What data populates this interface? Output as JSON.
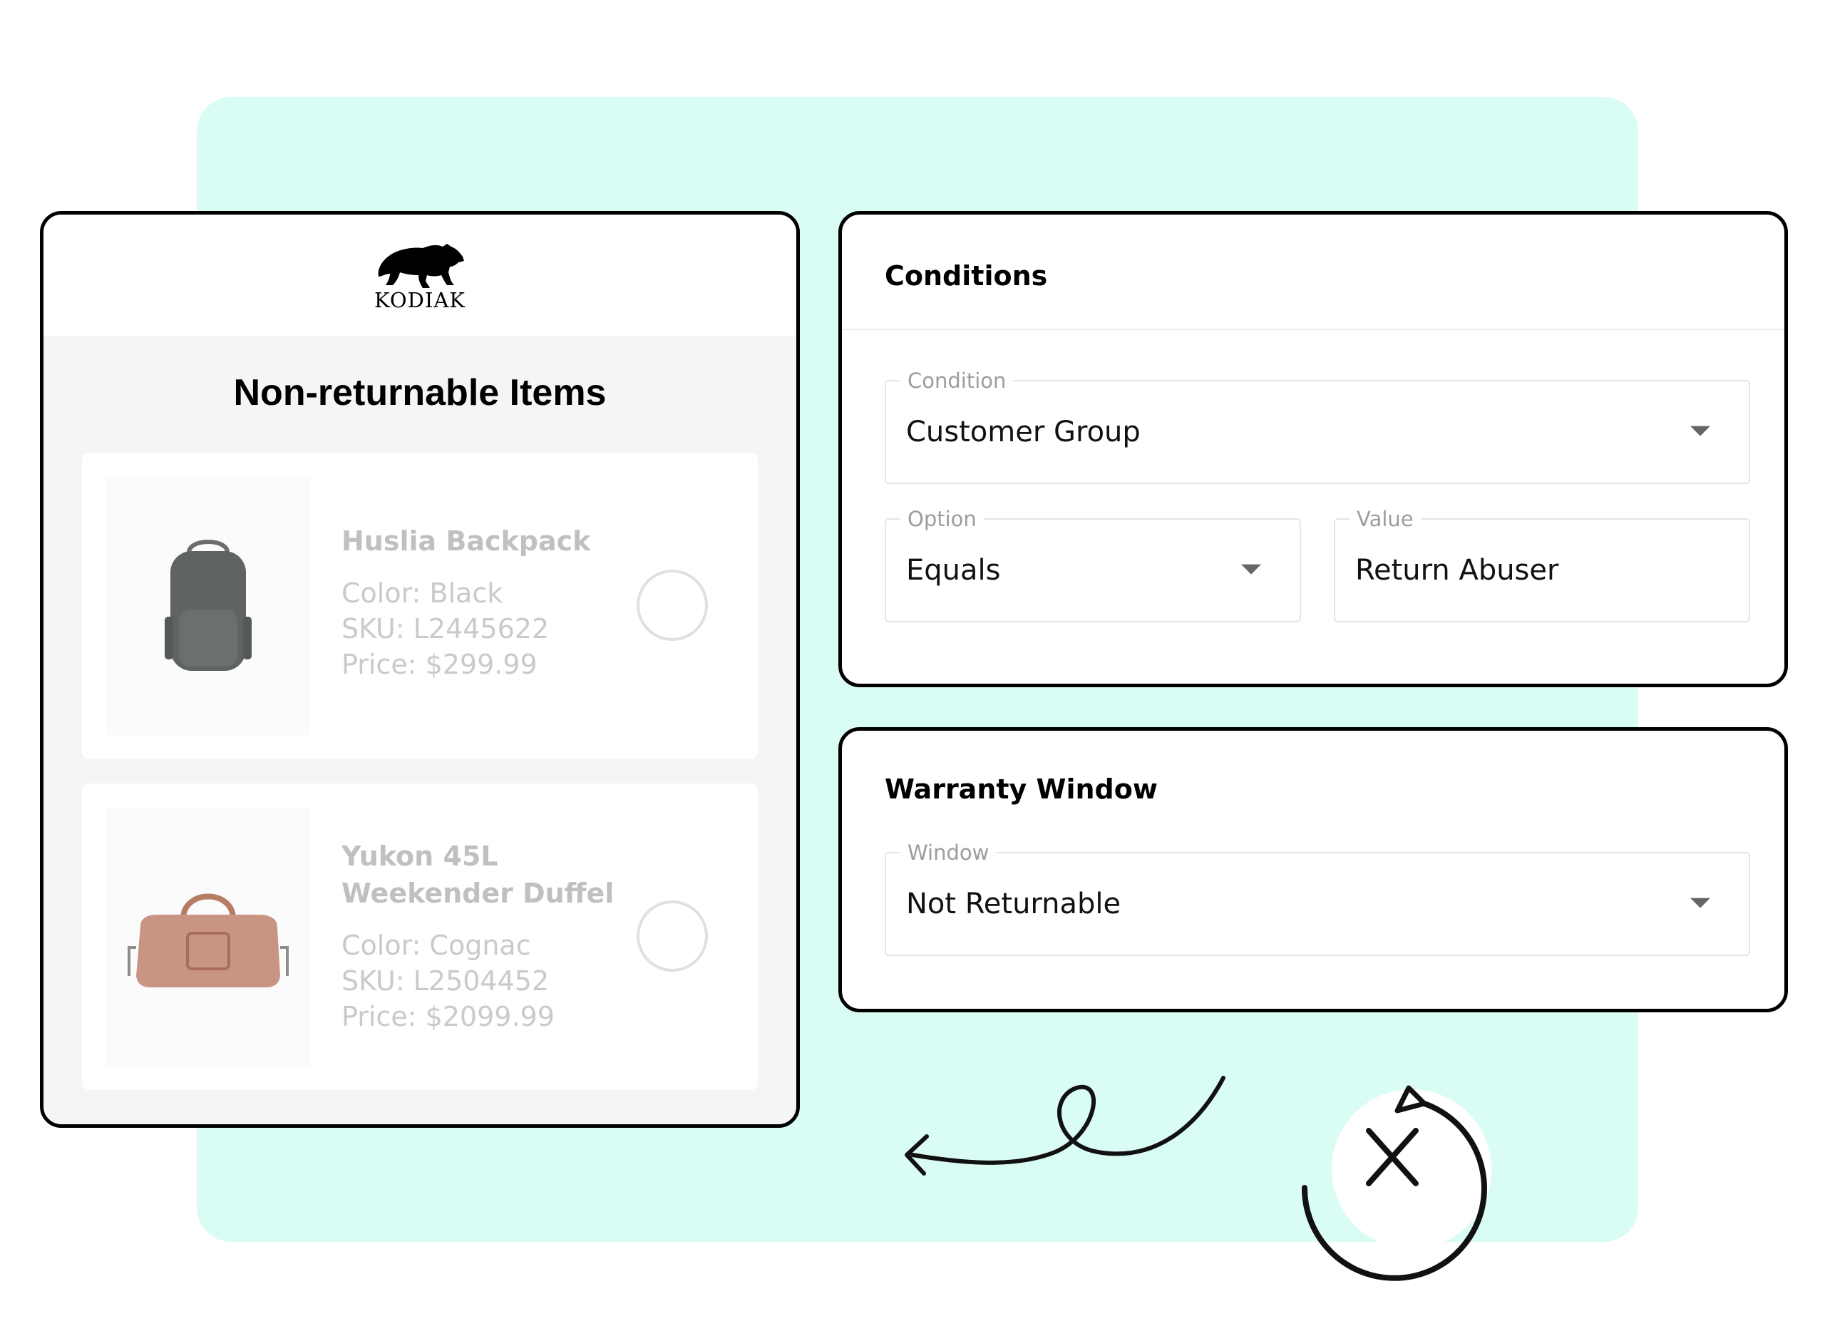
{
  "store": {
    "brand": "KODIAK",
    "title": "Non-returnable Items",
    "items": [
      {
        "name": "Huslia Backpack",
        "color": "Color: Black",
        "sku": "SKU: L2445622",
        "price": "Price: $299.99"
      },
      {
        "name_line1": "Yukon 45L",
        "name_line2": "Weekender Duffel",
        "color": "Color: Cognac",
        "sku": "SKU: L2504452",
        "price": "Price: $2099.99"
      }
    ]
  },
  "conditions": {
    "title": "Conditions",
    "condition": {
      "label": "Condition",
      "value": "Customer Group"
    },
    "option": {
      "label": "Option",
      "value": "Equals"
    },
    "value": {
      "label": "Value",
      "value": "Return Abuser"
    }
  },
  "warranty": {
    "title": "Warranty Window",
    "window": {
      "label": "Window",
      "value": "Not Returnable"
    }
  },
  "colors": {
    "background_accent": "#d9fdf4",
    "border": "#000000",
    "muted_text": "#c1c4c3"
  },
  "icons": [
    "bear-logo-icon",
    "backpack-icon",
    "duffel-bag-icon",
    "chevron-down-icon",
    "curly-arrow-icon",
    "no-return-clock-icon"
  ]
}
